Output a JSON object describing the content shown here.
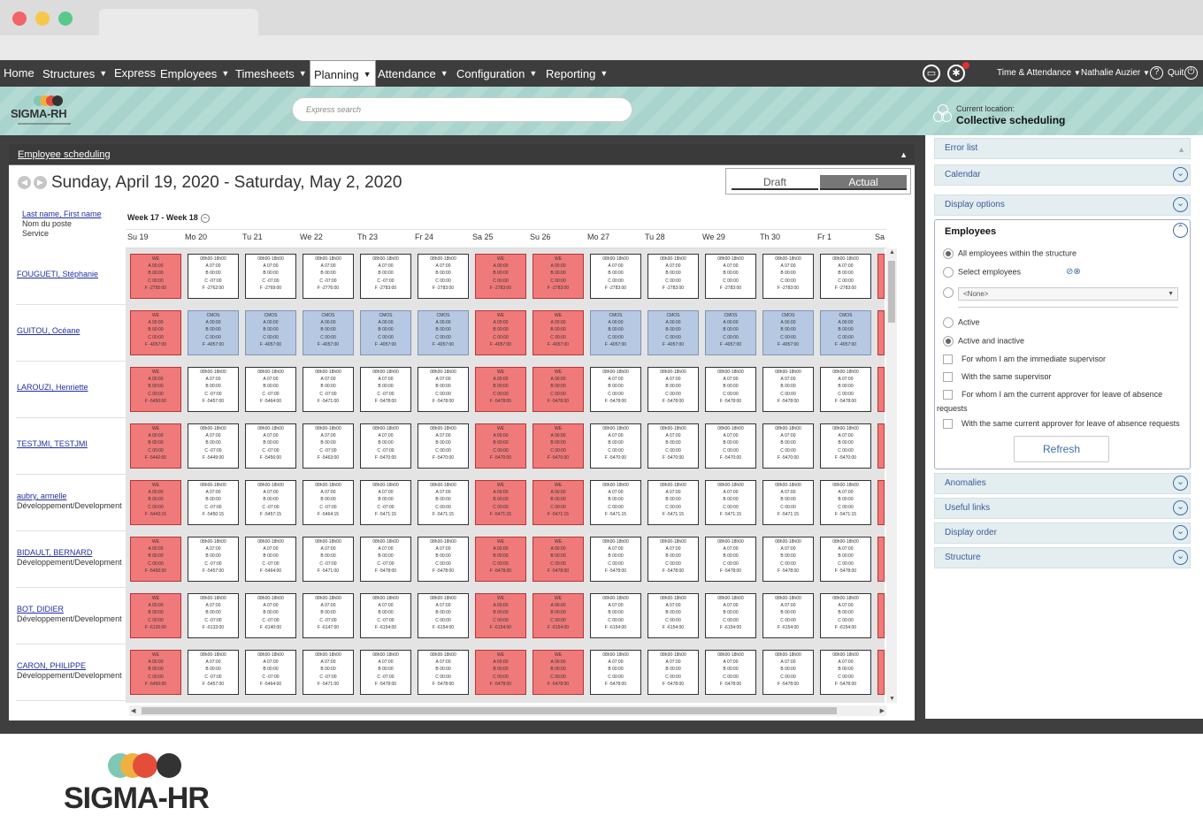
{
  "nav": {
    "items": [
      {
        "label": "Home",
        "caret": false
      },
      {
        "label": "Structures",
        "caret": true
      },
      {
        "label": "Express",
        "caret": false
      },
      {
        "label": "Employees",
        "caret": true
      },
      {
        "label": "Timesheets",
        "caret": true
      },
      {
        "label": "Planning",
        "caret": true,
        "active": true
      },
      {
        "label": "Attendance",
        "caret": true
      },
      {
        "label": "Configuration",
        "caret": true
      },
      {
        "label": "Reporting",
        "caret": true
      }
    ],
    "module": "Time & Attendance",
    "user": "Nathalie Auzier",
    "quit": "Quit"
  },
  "header": {
    "logo_text": "SIGMA-RH",
    "search_placeholder": "Express search",
    "location_label": "Current location:",
    "location_value": "Collective scheduling"
  },
  "panel": {
    "title": "Employee scheduling",
    "date_range": "Sunday, April 19, 2020 - Saturday, May 2, 2020",
    "toggle_draft": "Draft",
    "toggle_actual": "Actual",
    "col_head_link": "Last name, First name",
    "col_head_sub1": "Nom du poste",
    "col_head_sub2": "Service",
    "week_label": "Week 17 - Week 18",
    "days": [
      "Su 19",
      "Mo 20",
      "Tu 21",
      "We 22",
      "Th 23",
      "Fr 24",
      "Sa 25",
      "Su 26",
      "Mo 27",
      "Tu 28",
      "We 29",
      "Th 30",
      "Fr 1",
      "Sa"
    ]
  },
  "employees": [
    {
      "name": "FOUGUETI, Stéphanie",
      "dept": "",
      "pattern": "std",
      "f": [
        "F -2755:00",
        "F -2762:00",
        "F -2769:00",
        "F -2776:00",
        "F -2783:00",
        "F -2783:00",
        "F -2783:00",
        "F -2783:00",
        "F -2783:00",
        "F -2783:00",
        "F -2783:00",
        "F -2783:00",
        "F -2783:00"
      ]
    },
    {
      "name": "GUITOU, Océane",
      "dept": "",
      "pattern": "cmos",
      "f": [
        "F -4057:00",
        "F -4057:00",
        "F -4057:00",
        "F -4057:00",
        "F -4057:00",
        "F -4057:00",
        "F -4057:00",
        "F -4057:00",
        "F -4057:00",
        "F -4057:00",
        "F -4057:00",
        "F -4057:00",
        "F -4057:00"
      ]
    },
    {
      "name": "LAROUZI, Henriette",
      "dept": "",
      "pattern": "std",
      "f": [
        "F -5450:00",
        "F -5457:00",
        "F -5464:00",
        "F -5471:00",
        "F -5478:00",
        "F -5478:00",
        "F -5478:00",
        "F -5478:00",
        "F -5478:00",
        "F -5478:00",
        "F -5478:00",
        "F -5478:00",
        "F -5478:00"
      ]
    },
    {
      "name": "TESTJMI, TESTJMI",
      "dept": "",
      "pattern": "std",
      "f": [
        "F -5442:00",
        "F -5449:00",
        "F -5456:00",
        "F -5463:00",
        "F -5470:00",
        "F -5470:00",
        "F -5470:00",
        "F -5470:00",
        "F -5470:00",
        "F -5470:00",
        "F -5470:00",
        "F -5470:00",
        "F -5470:00"
      ]
    },
    {
      "name": "aubry, armelle",
      "dept": "Développement/Development",
      "pattern": "std",
      "f": [
        "F -5443:15",
        "F -5450:15",
        "F -5457:15",
        "F -5464:15",
        "F -5471:15",
        "F -5471:15",
        "F -5471:15",
        "F -5471:15",
        "F -5471:15",
        "F -5471:15",
        "F -5471:15",
        "F -5471:15",
        "F -5471:15"
      ]
    },
    {
      "name": "BIDAULT, BERNARD",
      "dept": "Développement/Development",
      "pattern": "std",
      "f": [
        "F -5450:00",
        "F -5457:00",
        "F -5464:00",
        "F -5471:00",
        "F -5478:00",
        "F -5478:00",
        "F -5478:00",
        "F -5478:00",
        "F -5478:00",
        "F -5478:00",
        "F -5478:00",
        "F -5478:00",
        "F -5478:00"
      ]
    },
    {
      "name": "BOT, DIDIER",
      "dept": "Développement/Development",
      "pattern": "std",
      "f": [
        "F -6126:00",
        "F -6133:00",
        "F -6140:00",
        "F -6147:00",
        "F -6154:00",
        "F -6154:00",
        "F -6154:00",
        "F -6154:00",
        "F -6154:00",
        "F -6154:00",
        "F -6154:00",
        "F -6154:00",
        "F -6154:00"
      ]
    },
    {
      "name": "CARON, PHILIPPE",
      "dept": "Développement/Development",
      "pattern": "std",
      "f": [
        "F -5450:00",
        "F -5457:00",
        "F -5464:00",
        "F -5471:00",
        "F -5478:00",
        "F -5478:00",
        "F -5478:00",
        "F -5478:00",
        "F -5478:00",
        "F -5478:00",
        "F -5478:00",
        "F -5478:00",
        "F -5478:00"
      ]
    }
  ],
  "cell_text": {
    "we_lines": [
      "WE",
      "A 00:00",
      "B 00:00",
      "C 00:00"
    ],
    "cmos_lines": [
      "CMOS",
      "A 00:00",
      "B 00:00",
      "C 00:00"
    ],
    "shift_head": "08h00-18h00",
    "shift_a": "A 07:00",
    "shift_b": "B 00:00",
    "shift_c_neg": "C -07:00",
    "shift_c_zero": "C 00:00"
  },
  "colors": {
    "weekend": "#f07a7a",
    "cmos": "#b7c9e2",
    "nav_bg": "#3d3d3d",
    "accent": "#3a6ea8"
  },
  "sidebar": {
    "error_list": "Error list",
    "calendar": "Calendar",
    "display_options": "Display options",
    "employees_title": "Employees",
    "opt_all": "All employees within the structure",
    "opt_select": "Select employees",
    "opt_none": "<None>",
    "opt_active": "Active",
    "opt_active_inactive": "Active and inactive",
    "chk_immediate": "For whom I am the immediate supervisor",
    "chk_same_sup": "With the same supervisor",
    "chk_approver_1": "For whom I am the current approver for leave of absence",
    "chk_approver_2": "requests",
    "chk_same_approver": "With the same current approver for leave of absence requests",
    "refresh": "Refresh",
    "anomalies": "Anomalies",
    "useful_links": "Useful links",
    "display_order": "Display order",
    "structure": "Structure"
  },
  "footer_logo": "SIGMA-HR"
}
